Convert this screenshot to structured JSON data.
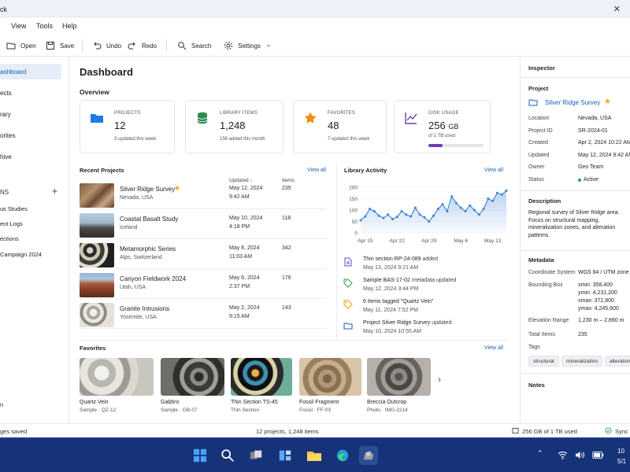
{
  "window": {
    "title_fragment": "ck"
  },
  "menu": [
    "View",
    "Tools",
    "Help"
  ],
  "toolbar": {
    "open": "Open",
    "save": "Save",
    "undo": "Undo",
    "redo": "Redo",
    "search": "Search",
    "settings": "Settings"
  },
  "sidebar": {
    "items": [
      "ashboard",
      "ects",
      "rary",
      "orites",
      "hive"
    ],
    "section_label": "NS",
    "add_symbol": "+",
    "sub_items": [
      "us Studies",
      "ent Logs",
      "ections",
      "Campaign 2024"
    ],
    "bottom_item": "n"
  },
  "dashboard": {
    "title": "Dashboard",
    "overview_title": "Overview",
    "cards": [
      {
        "label": "PROJECTS",
        "value": "12",
        "sub": "3 updated this week"
      },
      {
        "label": "LIBRARY ITEMS",
        "value": "1,248",
        "sub": "156 added this month"
      },
      {
        "label": "FAVORITES",
        "value": "48",
        "sub": "7 updated this week"
      },
      {
        "label": "DISK USAGE",
        "value": "256",
        "unit": "GB",
        "sub": "of 1 TB used",
        "progress": 0.256
      }
    ],
    "colors": {
      "accent": "#1a5fb4",
      "usage_bar": "#6a3fb8",
      "star": "#f2a900",
      "library": "#2e8b57"
    }
  },
  "recent_projects": {
    "title": "Recent Projects",
    "view_all": "View all",
    "col_updated": "Updated",
    "col_updated_sort": "↓",
    "col_items": "Items",
    "rows": [
      {
        "name": "Silver Ridge Survey",
        "location": "Nevada, USA",
        "date": "May 12, 2024",
        "time": "9:42 AM",
        "items": "235",
        "starred": true,
        "star": "★"
      },
      {
        "name": "Coastal Basalt Study",
        "location": "Iceland",
        "date": "May 10, 2024",
        "time": "4:18 PM",
        "items": "118",
        "starred": false
      },
      {
        "name": "Metamorphic Series",
        "location": "Alps, Switzerland",
        "date": "May 8, 2024",
        "time": "11:03 AM",
        "items": "342",
        "starred": false
      },
      {
        "name": "Canyon Fieldwork 2024",
        "location": "Utah, USA",
        "date": "May 6, 2024",
        "time": "2:37 PM",
        "items": "176",
        "starred": false
      },
      {
        "name": "Granite Intrusions",
        "location": "Yosemite, USA",
        "date": "May 2, 2024",
        "time": "9:15 AM",
        "items": "143",
        "starred": false
      }
    ]
  },
  "library_activity": {
    "title": "Library Activity",
    "view_all": "View all",
    "events": [
      {
        "icon": "document-icon",
        "bold": "Thin section RP-24-089",
        "rest": " added",
        "date": "May 13, 2024  9:21 AM"
      },
      {
        "icon": "tag-icon",
        "bold": "Sample BAS-17-02",
        "rest": " metadata updated",
        "date": "May 12, 2024  3:44 PM"
      },
      {
        "icon": "tag-icon",
        "bold": "6 items tagged \"Quartz Vein\"",
        "rest": "",
        "date": "May 11, 2024  7:52 PM"
      },
      {
        "icon": "folder-icon",
        "bold": "Project Silver Ridge Survey",
        "rest": " updated",
        "date": "May 10, 2024  10:55 AM"
      }
    ]
  },
  "chart_data": {
    "type": "area",
    "title": "",
    "xlabel": "",
    "ylabel": "",
    "ylim": [
      0,
      200
    ],
    "yticks": [
      0,
      50,
      100,
      150,
      200
    ],
    "xtick_labels": [
      "Apr 15",
      "Apr 22",
      "Apr 29",
      "May 6",
      "May 13"
    ],
    "xtick_index": [
      1,
      8,
      15,
      22,
      29
    ],
    "series": [
      {
        "values": [
          55,
          72,
          105,
          95,
          75,
          65,
          80,
          60,
          70,
          95,
          80,
          72,
          110,
          80,
          68,
          50,
          75,
          105,
          125,
          95,
          160,
          130,
          110,
          95,
          120,
          100,
          80,
          105,
          150,
          140,
          175,
          168,
          185
        ]
      }
    ],
    "grid": true,
    "color": "#3b82d6"
  },
  "favorites": {
    "title": "Favorites",
    "view_all": "View all",
    "next_symbol": "›",
    "items": [
      {
        "name": "Quartz Vein",
        "sub": "Sample · QZ-12"
      },
      {
        "name": "Gabbro",
        "sub": "Sample · GB-07"
      },
      {
        "name": "Thin Section TS-45",
        "sub": "Thin Section"
      },
      {
        "name": "Fossil Fragment",
        "sub": "Fossil · FF-03"
      },
      {
        "name": "Breccia Outcrop",
        "sub": "Photo · IMG-2214"
      }
    ]
  },
  "inspector": {
    "title": "Inspector",
    "project_heading": "Project",
    "project_name": "Silver Ridge Survey",
    "star": "★",
    "fields": [
      {
        "k": "Location",
        "v": "Nevada, USA"
      },
      {
        "k": "Project ID",
        "v": "SR-2024-01"
      },
      {
        "k": "Created",
        "v": "Apr 2, 2024 10:22 AM"
      },
      {
        "k": "Updated",
        "v": "May 12, 2024 9:42 AM"
      },
      {
        "k": "Owner",
        "v": "Geo Team"
      },
      {
        "k": "Status",
        "v": "Active"
      }
    ],
    "status_color": "#2e9e4f",
    "description_heading": "Description",
    "description": [
      "Regional survey of Silver Ridge area.",
      "Focus on structural mapping,",
      "mineralization zones, and alteration",
      "patterns."
    ],
    "metadata_heading": "Metadata",
    "meta": {
      "coord_k": "Coordinate System",
      "coord_v": "WGS 84 / UTM zone",
      "bbox_k": "Bounding Box",
      "bbox_v": [
        "xmin: 358,400",
        "ymin: 4,231,200",
        "xmax: 372,800",
        "ymax: 4,245,600"
      ],
      "elev_k": "Elevation Range",
      "elev_v": "1,230 m – 2,890 m",
      "total_k": "Total Items",
      "total_v": "235",
      "tags_k": "Tags",
      "tags": [
        "structural",
        "mineralization",
        "alteration"
      ]
    },
    "notes_heading": "Notes"
  },
  "statusbar": {
    "left": "ges saved",
    "center": "12 projects, 1,248 items",
    "disk": "256 GB of 1 TB used",
    "sync": "Sync c"
  },
  "taskbar": {
    "clock_line1": "10",
    "clock_line2": "5/1"
  }
}
